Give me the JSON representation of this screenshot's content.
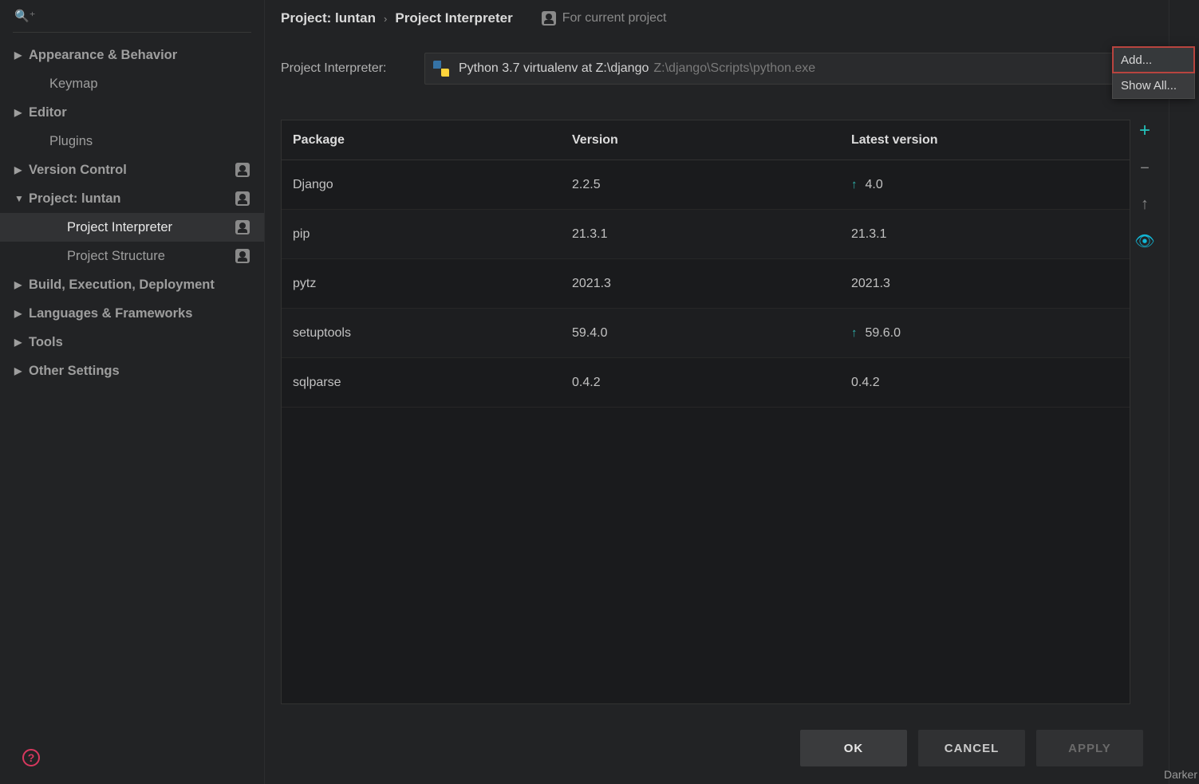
{
  "sidebar": {
    "items": [
      {
        "label": "Appearance & Behavior",
        "arrow": "▶",
        "bold": true
      },
      {
        "label": "Keymap",
        "arrow": "",
        "bold": false,
        "child": true
      },
      {
        "label": "Editor",
        "arrow": "▶",
        "bold": true
      },
      {
        "label": "Plugins",
        "arrow": "",
        "bold": false,
        "child": true
      },
      {
        "label": "Version Control",
        "arrow": "▶",
        "bold": true,
        "icon": true
      },
      {
        "label": "Project: luntan",
        "arrow": "▼",
        "bold": true,
        "icon": true
      },
      {
        "label": "Project Interpreter",
        "arrow": "",
        "bold": false,
        "sub": true,
        "icon": true,
        "selected": true
      },
      {
        "label": "Project Structure",
        "arrow": "",
        "bold": false,
        "sub": true,
        "icon": true
      },
      {
        "label": "Build, Execution, Deployment",
        "arrow": "▶",
        "bold": true
      },
      {
        "label": "Languages & Frameworks",
        "arrow": "▶",
        "bold": true
      },
      {
        "label": "Tools",
        "arrow": "▶",
        "bold": true
      },
      {
        "label": "Other Settings",
        "arrow": "▶",
        "bold": true
      }
    ]
  },
  "breadcrumb": {
    "a": "Project: luntan",
    "b": "Project Interpreter",
    "scope": "For current project"
  },
  "interpreter": {
    "label": "Project Interpreter:",
    "name": "Python 3.7 virtualenv at Z:\\django",
    "path": "Z:\\django\\Scripts\\python.exe"
  },
  "columns": {
    "pkg": "Package",
    "ver": "Version",
    "lat": "Latest version"
  },
  "packages": [
    {
      "name": "Django",
      "version": "2.2.5",
      "latest": "4.0",
      "upgrade": true
    },
    {
      "name": "pip",
      "version": "21.3.1",
      "latest": "21.3.1",
      "upgrade": false
    },
    {
      "name": "pytz",
      "version": "2021.3",
      "latest": "2021.3",
      "upgrade": false
    },
    {
      "name": "setuptools",
      "version": "59.4.0",
      "latest": "59.6.0",
      "upgrade": true
    },
    {
      "name": "sqlparse",
      "version": "0.4.2",
      "latest": "0.4.2",
      "upgrade": false
    }
  ],
  "popup": {
    "add": "Add...",
    "all": "Show All..."
  },
  "buttons": {
    "ok": "OK",
    "cancel": "CANCEL",
    "apply": "APPLY"
  },
  "edge_label": "Darker"
}
